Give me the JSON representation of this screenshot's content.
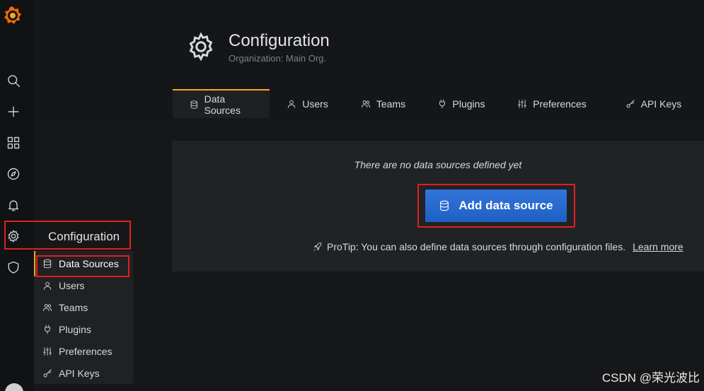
{
  "header": {
    "title": "Configuration",
    "subtitle": "Organization: Main Org."
  },
  "tabs": [
    {
      "label": "Data Sources",
      "icon": "database-icon",
      "active": true
    },
    {
      "label": "Users",
      "icon": "user-icon",
      "active": false
    },
    {
      "label": "Teams",
      "icon": "users-icon",
      "active": false
    },
    {
      "label": "Plugins",
      "icon": "plug-icon",
      "active": false
    },
    {
      "label": "Preferences",
      "icon": "sliders-icon",
      "active": false
    },
    {
      "label": "API Keys",
      "icon": "key-icon",
      "active": false
    }
  ],
  "main": {
    "empty_message": "There are no data sources defined yet",
    "add_button_label": "Add data source",
    "protip_text": "ProTip: You can also define data sources through configuration files.",
    "learn_more_label": "Learn more"
  },
  "sidebar": {
    "icons": [
      "grafana-logo-icon",
      "search-icon",
      "plus-icon",
      "dashboards-icon",
      "explore-icon",
      "alert-bell-icon",
      "gear-icon",
      "shield-icon"
    ]
  },
  "config_menu": {
    "title": "Configuration",
    "items": [
      {
        "label": "Data Sources",
        "icon": "database-icon"
      },
      {
        "label": "Users",
        "icon": "user-icon"
      },
      {
        "label": "Teams",
        "icon": "users-icon"
      },
      {
        "label": "Plugins",
        "icon": "plug-icon"
      },
      {
        "label": "Preferences",
        "icon": "sliders-icon"
      },
      {
        "label": "API Keys",
        "icon": "key-icon"
      }
    ]
  },
  "watermark": "CSDN @荣光波比",
  "colors": {
    "accent_orange": "#f5a623",
    "primary_blue": "#3274d9",
    "highlight_red": "#e02020"
  }
}
